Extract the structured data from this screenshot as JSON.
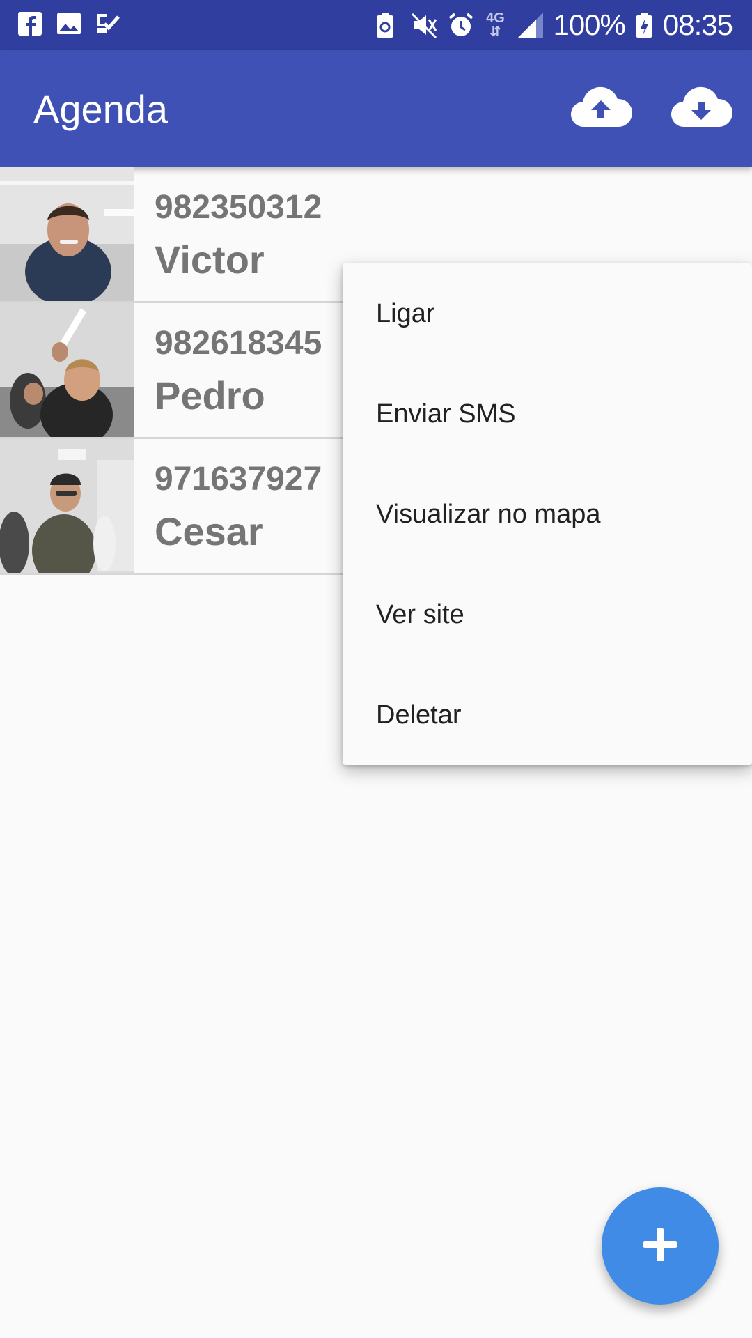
{
  "status_bar": {
    "battery_percent": "100%",
    "time": "08:35",
    "network": "4G",
    "icons": [
      "facebook-icon",
      "image-icon",
      "tasks-icon",
      "battery-saver-icon",
      "mute-icon",
      "alarm-icon",
      "signal-icon",
      "battery-charging-icon"
    ]
  },
  "app_bar": {
    "title": "Agenda",
    "actions": [
      "cloud-upload-icon",
      "cloud-download-icon"
    ]
  },
  "contacts": [
    {
      "phone": "982350312",
      "name": "Victor"
    },
    {
      "phone": "982618345",
      "name": "Pedro"
    },
    {
      "phone": "971637927",
      "name": "Cesar"
    }
  ],
  "context_menu": {
    "items": [
      "Ligar",
      "Enviar SMS",
      "Visualizar no mapa",
      "Ver site",
      "Deletar"
    ]
  },
  "fab": {
    "icon": "add-icon"
  },
  "colors": {
    "status_bar": "#303f9f",
    "app_bar": "#3f51b5",
    "fab": "#3f8be6",
    "contact_text": "#757575"
  }
}
